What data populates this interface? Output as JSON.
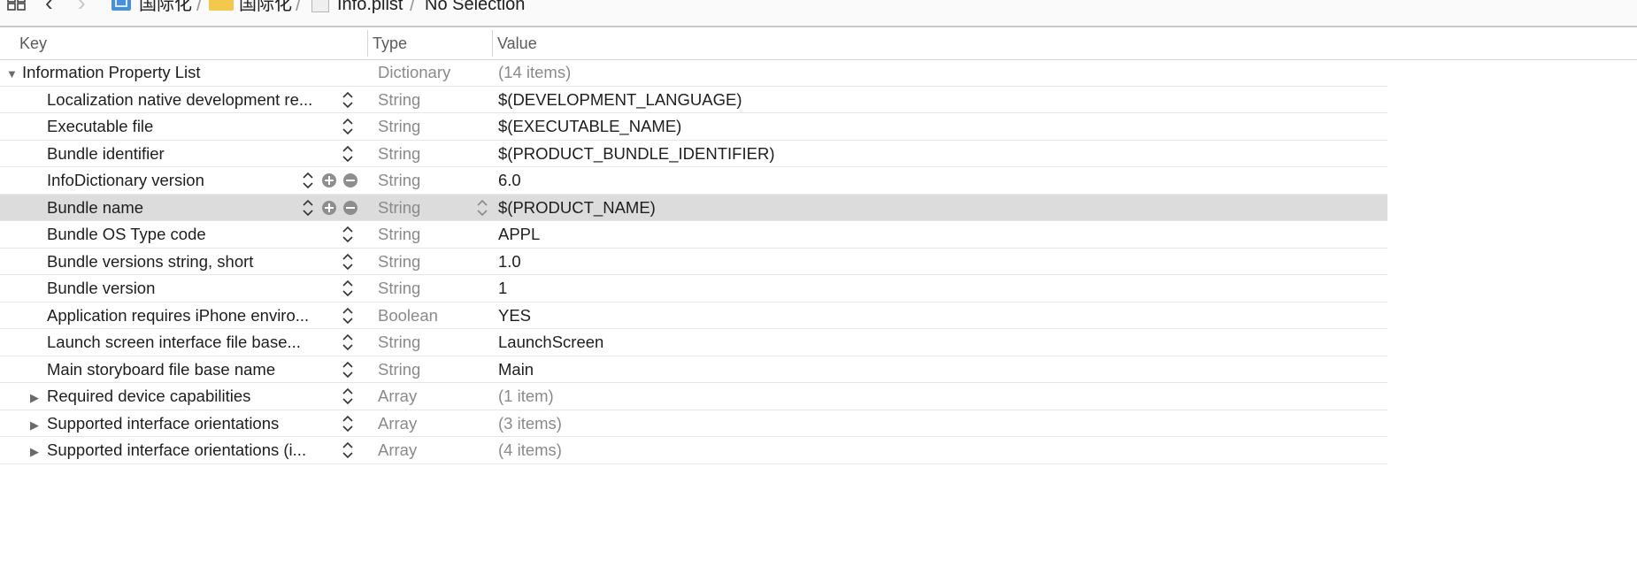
{
  "jumpbar": {
    "crumbs": [
      "国际化",
      "国际化",
      "Info.plist",
      "No Selection"
    ],
    "icons": [
      "related-items-icon",
      "back-icon",
      "forward-icon",
      "project-icon",
      "folder-icon",
      "plist-file-icon"
    ]
  },
  "columns": {
    "key": "Key",
    "type": "Type",
    "value": "Value"
  },
  "rows": [
    {
      "key": "Information Property List",
      "type": "Dictionary",
      "value": "(14 items)"
    },
    {
      "key": "Localization native development re...",
      "type": "String",
      "value": "$(DEVELOPMENT_LANGUAGE)"
    },
    {
      "key": "Executable file",
      "type": "String",
      "value": "$(EXECUTABLE_NAME)"
    },
    {
      "key": "Bundle identifier",
      "type": "String",
      "value": "$(PRODUCT_BUNDLE_IDENTIFIER)"
    },
    {
      "key": "InfoDictionary version",
      "type": "String",
      "value": "6.0"
    },
    {
      "key": "Bundle name",
      "type": "String",
      "value": "$(PRODUCT_NAME)"
    },
    {
      "key": "Bundle OS Type code",
      "type": "String",
      "value": "APPL"
    },
    {
      "key": "Bundle versions string, short",
      "type": "String",
      "value": "1.0"
    },
    {
      "key": "Bundle version",
      "type": "String",
      "value": "1"
    },
    {
      "key": "Application requires iPhone enviro...",
      "type": "Boolean",
      "value": "YES"
    },
    {
      "key": "Launch screen interface file base...",
      "type": "String",
      "value": "LaunchScreen"
    },
    {
      "key": "Main storyboard file base name",
      "type": "String",
      "value": "Main"
    },
    {
      "key": "Required device capabilities",
      "type": "Array",
      "value": "(1 item)"
    },
    {
      "key": "Supported interface orientations",
      "type": "Array",
      "value": "(3 items)"
    },
    {
      "key": "Supported interface orientations (i...",
      "type": "Array",
      "value": "(4 items)"
    }
  ],
  "colors": {
    "selected_row": "#dcdcdc",
    "dim_text": "#8a8a8a",
    "folder": "#f2c94c",
    "project": "#4a90d9"
  }
}
